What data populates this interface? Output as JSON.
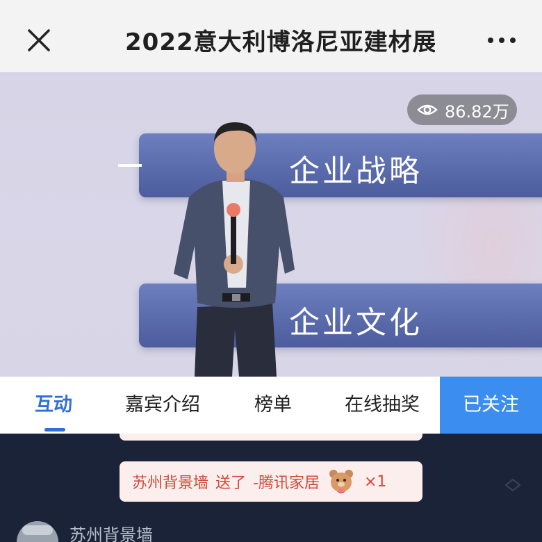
{
  "header": {
    "title": "2022意大利博洛尼亚建材展",
    "close_icon": "close-icon",
    "more_icon": "more-dots-icon"
  },
  "video": {
    "view_count": "86.82万",
    "view_icon": "eye-icon",
    "slide_items": [
      "企业战略",
      "企业文化"
    ]
  },
  "tabs": {
    "items": [
      {
        "label": "互动",
        "active": true
      },
      {
        "label": "嘉宾介绍",
        "active": false
      },
      {
        "label": "榜单",
        "active": false
      },
      {
        "label": "在线抽奖",
        "active": false
      }
    ],
    "follow_label": "已关注",
    "accent_color": "#2f6fd6",
    "follow_color": "#3b8ef0"
  },
  "chat": {
    "gift_message": {
      "sender": "苏州背景墙",
      "action": "送了",
      "recipient": "-腾讯家居",
      "gift_icon": "bear-gift-icon",
      "count": "×1"
    },
    "next_user": "苏州背景墙"
  }
}
